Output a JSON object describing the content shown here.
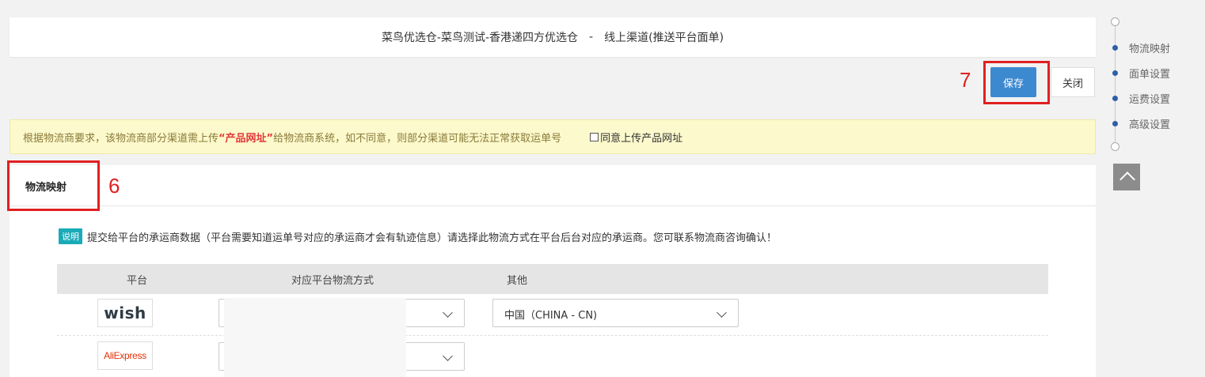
{
  "header": {
    "title_left": "菜鸟优选仓-菜鸟测试-香港递四方优选仓",
    "separator": "-",
    "title_right": "线上渠道(推送平台面单)"
  },
  "toolbar": {
    "save_label": "保存",
    "close_label": "关闭"
  },
  "annotations": {
    "save_number": "7",
    "tab_number": "6"
  },
  "notice": {
    "text_before": "根据物流商要求，该物流商部分渠道需上传",
    "highlight": "“产品网址”",
    "text_after": "给物流商系统，如不同意，则部分渠道可能无法正常获取运单号",
    "agree_label": "同意上传产品网址",
    "agree_checked": false
  },
  "panel": {
    "tab_label": "物流映射",
    "explain_tag": "说明",
    "explain_text": "提交给平台的承运商数据（平台需要知道运单号对应的承运商才会有轨迹信息）请选择此物流方式在平台后台对应的承运商。您可联系物流商咨询确认！",
    "columns": [
      "平台",
      "对应平台物流方式",
      "其他"
    ],
    "rows": [
      {
        "platform": "wish",
        "shipping_method": "",
        "other": "中国（CHINA - CN)"
      },
      {
        "platform": "AliExpress",
        "shipping_method": "",
        "other": ""
      }
    ]
  },
  "side_nav": {
    "items": [
      "物流映射",
      "面单设置",
      "运费设置",
      "高级设置"
    ]
  },
  "colors": {
    "primary": "#3d89d0",
    "annotation": "#e02020",
    "notice_bg": "#fcf9cc",
    "nav_dot": "#2f5fa8"
  },
  "icons": [
    "chevron-down-icon",
    "chevron-up-icon",
    "checkbox-icon"
  ]
}
